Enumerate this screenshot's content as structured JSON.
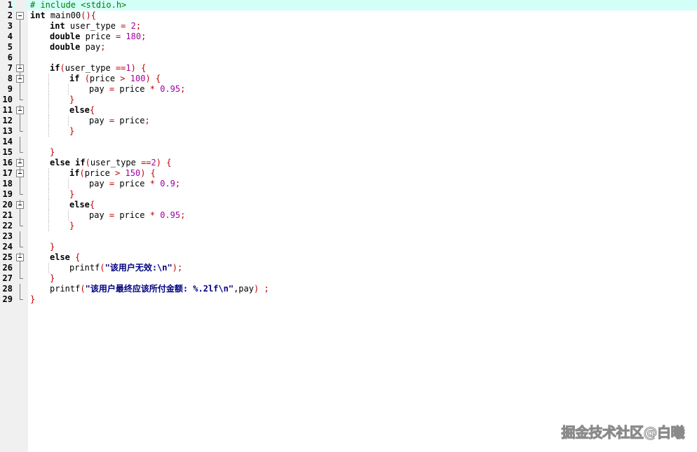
{
  "editor": {
    "lines": [
      {
        "n": "1",
        "fold": "none",
        "indent": 0,
        "current": true,
        "tokens": [
          [
            "pp",
            "# include <stdio.h>"
          ]
        ]
      },
      {
        "n": "2",
        "fold": "open",
        "indent": 0,
        "tokens": [
          [
            "kw",
            "int"
          ],
          [
            "txt",
            " main00"
          ],
          [
            "op",
            "()"
          ],
          [
            "op",
            "{"
          ]
        ]
      },
      {
        "n": "3",
        "fold": "line",
        "indent": 1,
        "tokens": [
          [
            "kw",
            "int"
          ],
          [
            "txt",
            " user_type "
          ],
          [
            "op",
            "="
          ],
          [
            "txt",
            " "
          ],
          [
            "num",
            "2"
          ],
          [
            "op",
            ";"
          ]
        ]
      },
      {
        "n": "4",
        "fold": "line",
        "indent": 1,
        "tokens": [
          [
            "kw",
            "double"
          ],
          [
            "txt",
            " price "
          ],
          [
            "op",
            "="
          ],
          [
            "txt",
            " "
          ],
          [
            "num",
            "180"
          ],
          [
            "op",
            ";"
          ]
        ]
      },
      {
        "n": "5",
        "fold": "line",
        "indent": 1,
        "tokens": [
          [
            "kw",
            "double"
          ],
          [
            "txt",
            " pay"
          ],
          [
            "op",
            ";"
          ]
        ]
      },
      {
        "n": "6",
        "fold": "line",
        "indent": 0,
        "tokens": []
      },
      {
        "n": "7",
        "fold": "open",
        "indent": 1,
        "tokens": [
          [
            "kw",
            "if"
          ],
          [
            "op",
            "("
          ],
          [
            "txt",
            "user_type "
          ],
          [
            "op",
            "=="
          ],
          [
            "num",
            "1"
          ],
          [
            "op",
            ")"
          ],
          [
            "txt",
            " "
          ],
          [
            "op",
            "{"
          ]
        ]
      },
      {
        "n": "8",
        "fold": "open",
        "indent": 2,
        "tokens": [
          [
            "kw",
            "if"
          ],
          [
            "txt",
            " "
          ],
          [
            "op",
            "("
          ],
          [
            "txt",
            "price "
          ],
          [
            "op",
            ">"
          ],
          [
            "txt",
            " "
          ],
          [
            "num",
            "100"
          ],
          [
            "op",
            ")"
          ],
          [
            "txt",
            " "
          ],
          [
            "op",
            "{"
          ]
        ]
      },
      {
        "n": "9",
        "fold": "line",
        "indent": 3,
        "tokens": [
          [
            "txt",
            "pay "
          ],
          [
            "op",
            "="
          ],
          [
            "txt",
            " price "
          ],
          [
            "op",
            "*"
          ],
          [
            "txt",
            " "
          ],
          [
            "num",
            "0.95"
          ],
          [
            "op",
            ";"
          ]
        ]
      },
      {
        "n": "10",
        "fold": "end",
        "indent": 2,
        "tokens": [
          [
            "op",
            "}"
          ]
        ]
      },
      {
        "n": "11",
        "fold": "open",
        "indent": 2,
        "tokens": [
          [
            "kw",
            "else"
          ],
          [
            "op",
            "{"
          ]
        ]
      },
      {
        "n": "12",
        "fold": "line",
        "indent": 3,
        "tokens": [
          [
            "txt",
            "pay "
          ],
          [
            "op",
            "="
          ],
          [
            "txt",
            " price"
          ],
          [
            "op",
            ";"
          ]
        ]
      },
      {
        "n": "13",
        "fold": "end",
        "indent": 2,
        "tokens": [
          [
            "op",
            "}"
          ]
        ]
      },
      {
        "n": "14",
        "fold": "line",
        "indent": 0,
        "tokens": []
      },
      {
        "n": "15",
        "fold": "end",
        "indent": 1,
        "tokens": [
          [
            "op",
            "}"
          ]
        ]
      },
      {
        "n": "16",
        "fold": "open",
        "indent": 1,
        "tokens": [
          [
            "kw",
            "else"
          ],
          [
            "txt",
            " "
          ],
          [
            "kw",
            "if"
          ],
          [
            "op",
            "("
          ],
          [
            "txt",
            "user_type "
          ],
          [
            "op",
            "=="
          ],
          [
            "num",
            "2"
          ],
          [
            "op",
            ")"
          ],
          [
            "txt",
            " "
          ],
          [
            "op",
            "{"
          ]
        ]
      },
      {
        "n": "17",
        "fold": "open",
        "indent": 2,
        "tokens": [
          [
            "kw",
            "if"
          ],
          [
            "op",
            "("
          ],
          [
            "txt",
            "price "
          ],
          [
            "op",
            ">"
          ],
          [
            "txt",
            " "
          ],
          [
            "num",
            "150"
          ],
          [
            "op",
            ")"
          ],
          [
            "txt",
            " "
          ],
          [
            "op",
            "{"
          ]
        ]
      },
      {
        "n": "18",
        "fold": "line",
        "indent": 3,
        "tokens": [
          [
            "txt",
            "pay "
          ],
          [
            "op",
            "="
          ],
          [
            "txt",
            " price "
          ],
          [
            "op",
            "*"
          ],
          [
            "txt",
            " "
          ],
          [
            "num",
            "0.9"
          ],
          [
            "op",
            ";"
          ]
        ]
      },
      {
        "n": "19",
        "fold": "end",
        "indent": 2,
        "tokens": [
          [
            "op",
            "}"
          ]
        ]
      },
      {
        "n": "20",
        "fold": "open",
        "indent": 2,
        "tokens": [
          [
            "kw",
            "else"
          ],
          [
            "op",
            "{"
          ]
        ]
      },
      {
        "n": "21",
        "fold": "line",
        "indent": 3,
        "tokens": [
          [
            "txt",
            "pay "
          ],
          [
            "op",
            "="
          ],
          [
            "txt",
            " price "
          ],
          [
            "op",
            "*"
          ],
          [
            "txt",
            " "
          ],
          [
            "num",
            "0.95"
          ],
          [
            "op",
            ";"
          ]
        ]
      },
      {
        "n": "22",
        "fold": "end",
        "indent": 2,
        "tokens": [
          [
            "op",
            "}"
          ]
        ]
      },
      {
        "n": "23",
        "fold": "line",
        "indent": 0,
        "tokens": []
      },
      {
        "n": "24",
        "fold": "end",
        "indent": 1,
        "tokens": [
          [
            "op",
            "}"
          ]
        ]
      },
      {
        "n": "25",
        "fold": "open",
        "indent": 1,
        "tokens": [
          [
            "kw",
            "else"
          ],
          [
            "txt",
            " "
          ],
          [
            "op",
            "{"
          ]
        ]
      },
      {
        "n": "26",
        "fold": "line",
        "indent": 2,
        "tokens": [
          [
            "txt",
            "printf"
          ],
          [
            "op",
            "("
          ],
          [
            "str",
            "\"该用户无效:\\n\""
          ],
          [
            "op",
            ");"
          ]
        ]
      },
      {
        "n": "27",
        "fold": "end",
        "indent": 1,
        "tokens": [
          [
            "op",
            "}"
          ]
        ]
      },
      {
        "n": "28",
        "fold": "line",
        "indent": 1,
        "tokens": [
          [
            "txt",
            "printf"
          ],
          [
            "op",
            "("
          ],
          [
            "str",
            "\"该用户最终应该所付金额: %.2lf\\n\""
          ],
          [
            "txt",
            ",pay"
          ],
          [
            "op",
            ")"
          ],
          [
            "txt",
            " "
          ],
          [
            "op",
            ";"
          ]
        ]
      },
      {
        "n": "29",
        "fold": "end",
        "indent": 0,
        "tokens": [
          [
            "op",
            "}"
          ]
        ]
      }
    ]
  },
  "colors": {
    "current_line": "#d4fff9",
    "gutter": "#f0f0f0",
    "preprocessor": "#008000",
    "number": "#a000a0",
    "operator": "#c00000",
    "string": "#000080"
  },
  "watermark": "掘金技术社区@白曦"
}
